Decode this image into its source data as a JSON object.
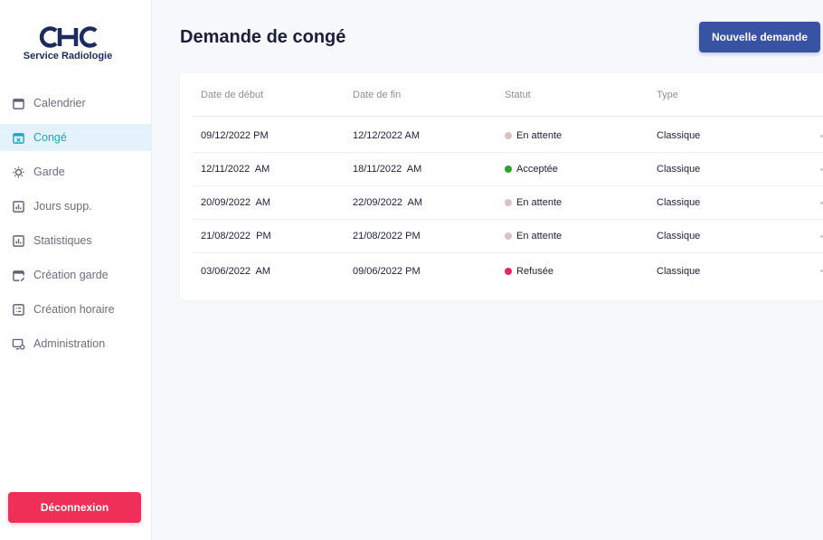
{
  "brand": {
    "logo_text": "CHC",
    "subtitle": "Service Radiologie"
  },
  "nav": [
    {
      "label": "Calendrier",
      "icon": "calendar-icon",
      "active": false
    },
    {
      "label": "Congé",
      "icon": "calendar-x-icon",
      "active": true
    },
    {
      "label": "Garde",
      "icon": "sun-moon-icon",
      "active": false
    },
    {
      "label": "Jours supp.",
      "icon": "bar-chart-icon",
      "active": false
    },
    {
      "label": "Statistiques",
      "icon": "bar-chart-icon",
      "active": false
    },
    {
      "label": "Création garde",
      "icon": "calendar-edit-icon",
      "active": false
    },
    {
      "label": "Création horaire",
      "icon": "list-icon",
      "active": false
    },
    {
      "label": "Administration",
      "icon": "monitor-gear-icon",
      "active": false
    }
  ],
  "logout_label": "Déconnexion",
  "page_title": "Demande de congé",
  "new_request_label": "Nouvelle demande",
  "table": {
    "headers": [
      "Date de début",
      "Date de fin",
      "Statut",
      "Type"
    ],
    "rows": [
      {
        "start": "09/12/2022 PM",
        "end": "12/12/2022 AM",
        "status": "En attente",
        "status_color": "#d9c2c2",
        "type": "Classique"
      },
      {
        "start": "12/11/2022  AM",
        "end": "18/11/2022  AM",
        "status": "Acceptée",
        "status_color": "#2aa52a",
        "type": "Classique"
      },
      {
        "start": "20/09/2022  AM",
        "end": "22/09/2022  AM",
        "status": "En attente",
        "status_color": "#d9c2c2",
        "type": "Classique"
      },
      {
        "start": "21/08/2022  PM",
        "end": "21/08/2022 PM",
        "status": "En attente",
        "status_color": "#d9c2c2",
        "type": "Classique"
      },
      {
        "start": "03/06/2022  AM",
        "end": "09/06/2022 PM",
        "status": "Refusée",
        "status_color": "#e8245a",
        "type": "Classique"
      }
    ]
  },
  "colors": {
    "accent": "#22a3c9",
    "primary": "#3852a4",
    "danger": "#ef2f57",
    "navy": "#1c2a5e"
  }
}
